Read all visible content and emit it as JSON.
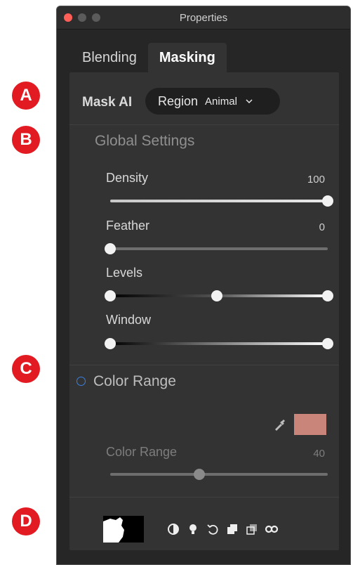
{
  "callouts": [
    "A",
    "B",
    "C",
    "D"
  ],
  "window": {
    "title": "Properties"
  },
  "tabs": [
    {
      "label": "Blending",
      "active": false
    },
    {
      "label": "Masking",
      "active": true
    }
  ],
  "mask_ai": {
    "label": "Mask AI",
    "region_label": "Region",
    "region_value": "Animal"
  },
  "global_settings": {
    "title": "Global Settings",
    "sliders": [
      {
        "label": "Density",
        "value": "100"
      },
      {
        "label": "Feather",
        "value": "0"
      },
      {
        "label": "Levels",
        "value": ""
      },
      {
        "label": "Window",
        "value": ""
      }
    ]
  },
  "color_range": {
    "title": "Color Range",
    "slider_label": "Color Range",
    "slider_value": "40",
    "swatch_color": "#c9857a"
  },
  "bottom_toolbar": {
    "icons": [
      "invert-icon",
      "lightbulb-icon",
      "undo-icon",
      "copy-mask-icon",
      "paste-mask-icon",
      "link-icon"
    ]
  },
  "colors": {
    "accent_callout": "#e21b23",
    "panel_bg": "#333333"
  }
}
